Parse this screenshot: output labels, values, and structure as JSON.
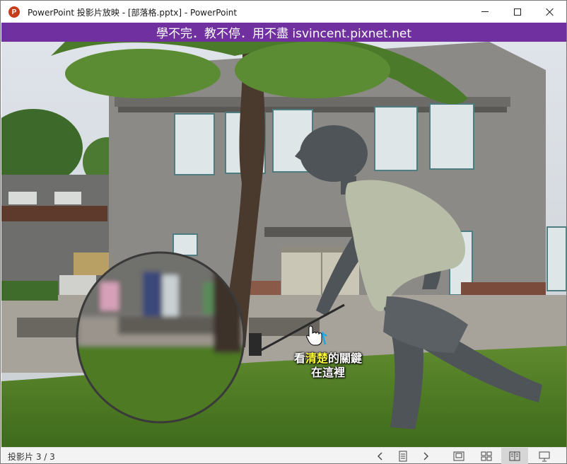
{
  "window": {
    "title": "PowerPoint 投影片放映 - [部落格.pptx] - PowerPoint",
    "app_icon_letter": "P"
  },
  "banner": {
    "text": "學不完．教不停．用不盡 isvincent.pixnet.net",
    "color": "#7030a0"
  },
  "slide": {
    "callout_pre": "看",
    "callout_highlight": "清楚",
    "callout_post": "的關鍵",
    "callout_line2": "在這裡",
    "highlight_color": "#ffff33"
  },
  "statusbar": {
    "slide_counter": "投影片 3 / 3",
    "buttons": [
      "previous-icon",
      "slide-menu-icon",
      "next-icon",
      "normal-view-icon",
      "slide-sorter-icon",
      "reading-view-icon",
      "slideshow-icon"
    ]
  }
}
